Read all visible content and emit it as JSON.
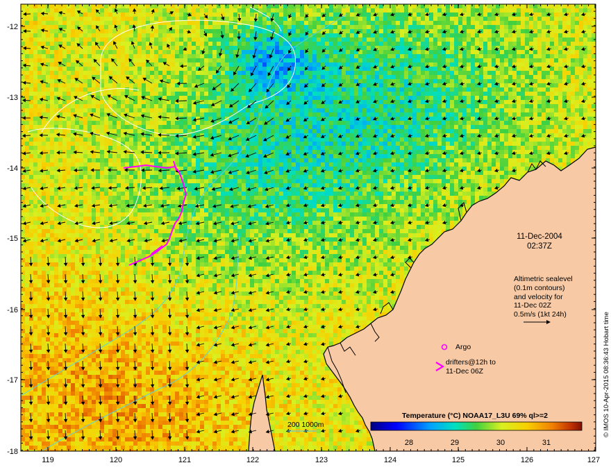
{
  "map": {
    "lon_range": [
      118.6,
      127.0
    ],
    "lat_range": [
      -18.0,
      -11.8
    ],
    "lon_ticks": [
      "119",
      "120",
      "121",
      "122",
      "123",
      "124",
      "125",
      "126",
      "127"
    ],
    "lat_ticks": [
      "-12",
      "-13",
      "-14",
      "-15",
      "-16",
      "-17",
      "-18"
    ]
  },
  "annotations": {
    "date": "11-Dec-2004",
    "time": "02:37Z",
    "altimetry_lines": [
      "Altimetric sealevel",
      "(0.1m contours)",
      "and velocity for",
      "11-Dec 02Z",
      "0.5m/s (1kt 24h)"
    ],
    "argo_label": "Argo",
    "drifters_lines": [
      "drifters@12h to",
      "11-Dec 06Z"
    ],
    "depth_label": "200  1000m",
    "credit": "© IMOS 10-Apr-2015 08:36:43 Hobart time"
  },
  "colorbar": {
    "title": "Temperature (°C) NOAA17_L3U 69% ql>=2",
    "range": [
      27.3,
      31.9
    ],
    "ticks": [
      "28",
      "29",
      "30",
      "31"
    ]
  },
  "colors": {
    "land": "#f7c9a4",
    "coast": "#000000",
    "contour": "#ffffff",
    "bathy_200": "#5fd0d8",
    "drifter": "#ff00ff",
    "argo": "#ff00ff"
  }
}
